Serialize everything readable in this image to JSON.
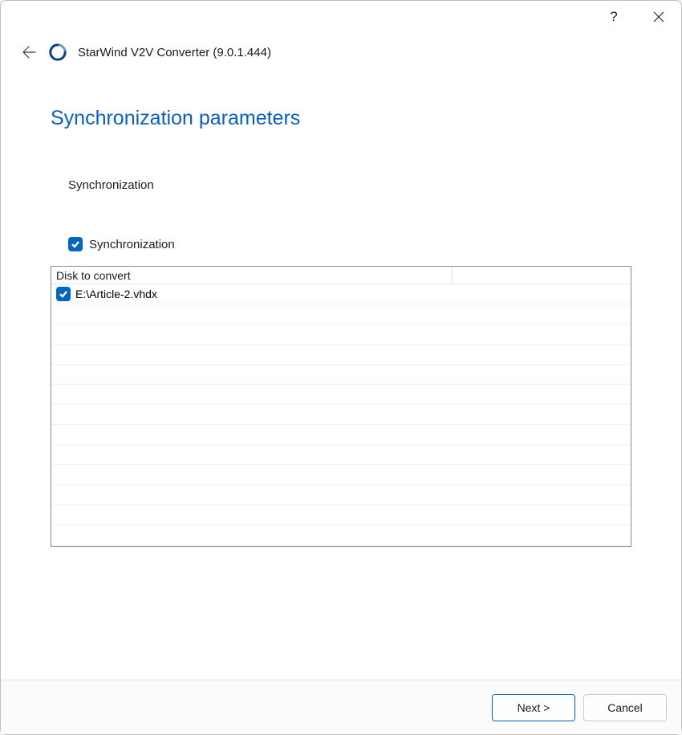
{
  "titlebar": {
    "help": "?",
    "close": "✕"
  },
  "header": {
    "app_title": "StarWind V2V Converter (9.0.1.444)"
  },
  "page": {
    "heading": "Synchronization parameters",
    "section_label": "Synchronization",
    "sync_checkbox_label": "Synchronization",
    "sync_checked": true
  },
  "table": {
    "columns": [
      "Disk to convert",
      ""
    ],
    "rows": [
      {
        "checked": true,
        "disk": "E:\\Article-2.vhdx",
        "col2": ""
      }
    ],
    "empty_row_count": 12
  },
  "footer": {
    "next_label": "Next >",
    "cancel_label": "Cancel"
  }
}
